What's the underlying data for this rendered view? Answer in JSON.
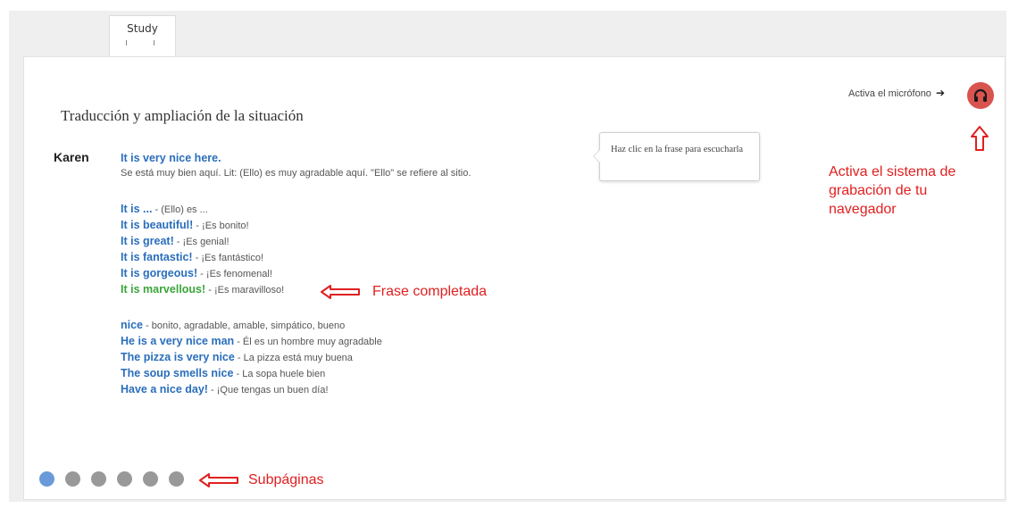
{
  "tabs": [
    {
      "label": "Study"
    }
  ],
  "header": {
    "mic_label": "Activa el micrófono",
    "mic_icon": "headphones-icon"
  },
  "section": {
    "title": "Traducción y ampliación de la situación",
    "speaker": "Karen",
    "phrase": "It is very nice here.",
    "translation": "Se está muy bien aquí. Lit: (Ello) es muy agradable aquí. \"Ello\" se refiere al sitio."
  },
  "tooltip": {
    "text": "Haz clic en la frase para escucharla"
  },
  "group1": [
    {
      "en": "It is ...",
      "es": " - (Ello) es ..."
    },
    {
      "en": "It is beautiful!",
      "es": " - ¡Es bonito!"
    },
    {
      "en": "It is great!",
      "es": " - ¡Es genial!"
    },
    {
      "en": "It is fantastic!",
      "es": " - ¡Es fantástico!"
    },
    {
      "en": "It is gorgeous!",
      "es": " - ¡Es fenomenal!"
    },
    {
      "en": "It is marvellous!",
      "es": " - ¡Es maravilloso!"
    }
  ],
  "group2": [
    {
      "en": "nice",
      "es": " - bonito, agradable, amable, simpático, bueno"
    },
    {
      "en": "He is a very nice man",
      "es": " - Él es un hombre muy agradable"
    },
    {
      "en": "The pizza is very nice",
      "es": " - La pizza está muy buena"
    },
    {
      "en": "The soup smells nice",
      "es": " - La sopa huele bien"
    },
    {
      "en": "Have a nice day!",
      "es": " - ¡Que tengas un buen día!"
    }
  ],
  "annotations": {
    "mic": "Activa el sistema de grabación de tu navegador",
    "completed": "Frase completada",
    "subpages": "Subpáginas"
  },
  "pagination": {
    "count": 6,
    "active_index": 0
  },
  "colors": {
    "phrase_blue": "#2a6ebb",
    "completed_green": "#3aa53a",
    "annotation_red": "#e02020",
    "mic_red": "#d9534f",
    "dot_active": "#6a9bd8",
    "dot_inactive": "#999999"
  }
}
